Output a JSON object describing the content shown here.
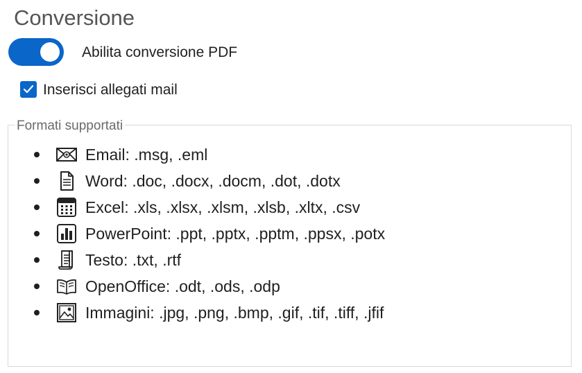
{
  "section": {
    "title": "Conversione"
  },
  "toggle": {
    "label": "Abilita conversione PDF",
    "state": "on",
    "color": "#0a66c9"
  },
  "checkbox": {
    "label": "Inserisci allegati mail",
    "checked": true
  },
  "formats": {
    "legend": "Formati supportati",
    "items": [
      {
        "icon": "email-icon",
        "text": "Email: .msg, .eml"
      },
      {
        "icon": "document-icon",
        "text": "Word: .doc, .docx, .docm, .dot, .dotx"
      },
      {
        "icon": "spreadsheet-icon",
        "text": "Excel: .xls, .xlsx, .xlsm, .xlsb, .xltx, .csv"
      },
      {
        "icon": "chart-icon",
        "text": "PowerPoint: .ppt, .pptx, .pptm, .ppsx, .potx"
      },
      {
        "icon": "text-file-icon",
        "text": "Testo: .txt, .rtf"
      },
      {
        "icon": "book-icon",
        "text": "OpenOffice: .odt, .ods, .odp"
      },
      {
        "icon": "image-icon",
        "text": "Immagini: .jpg, .png, .bmp, .gif, .tif, .tiff, .jfif"
      }
    ]
  }
}
